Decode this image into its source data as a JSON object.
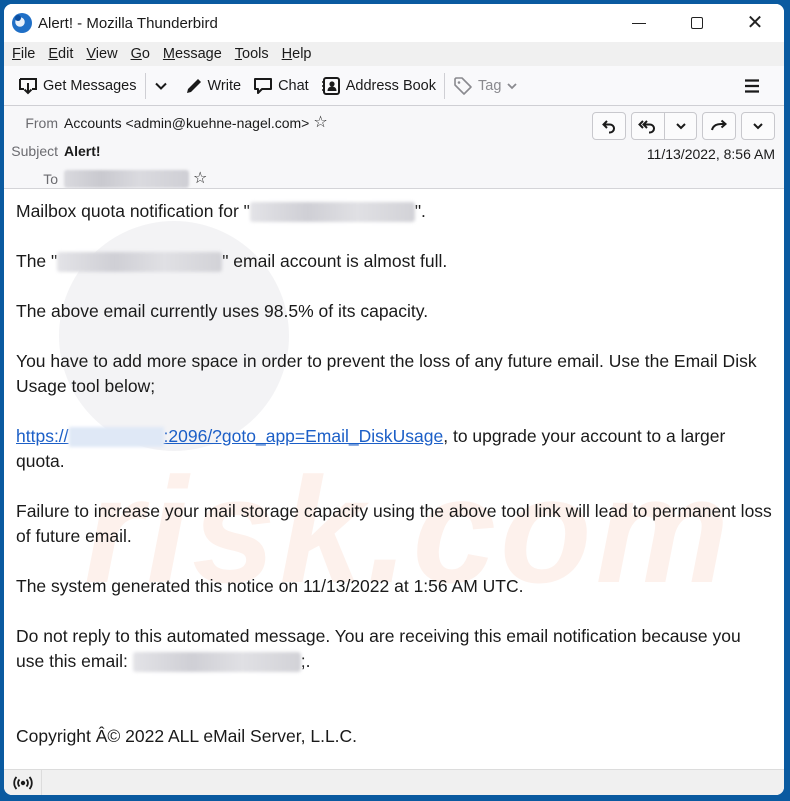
{
  "window": {
    "title": "Alert! - Mozilla Thunderbird",
    "controls": {
      "minimize": "minimize",
      "maximize": "maximize",
      "close": "close"
    }
  },
  "menu": {
    "items": [
      {
        "label": "File",
        "accel": "F",
        "rest": "ile"
      },
      {
        "label": "Edit",
        "accel": "E",
        "rest": "dit"
      },
      {
        "label": "View",
        "accel": "V",
        "rest": "iew"
      },
      {
        "label": "Go",
        "accel": "G",
        "rest": "o"
      },
      {
        "label": "Message",
        "accel": "M",
        "rest": "essage"
      },
      {
        "label": "Tools",
        "accel": "T",
        "rest": "ools"
      },
      {
        "label": "Help",
        "accel": "H",
        "rest": "elp"
      }
    ]
  },
  "toolbar": {
    "get_messages": "Get Messages",
    "write": "Write",
    "chat": "Chat",
    "address_book": "Address Book",
    "tag": "Tag"
  },
  "header": {
    "from_label": "From",
    "from_value": "Accounts <admin@kuehne-nagel.com>",
    "subject_label": "Subject",
    "subject_value": "Alert!",
    "to_label": "To",
    "to_value": "[redacted]",
    "date": "11/13/2022, 8:56 AM",
    "actions": [
      "reply",
      "reply-all",
      "reply-all-menu",
      "forward",
      "more-menu"
    ]
  },
  "message": {
    "p1_prefix": "Mailbox quota notification for \"",
    "p1_suffix": "\".",
    "p2_prefix": "The \"",
    "p2_suffix": "\" email account is almost full.",
    "p3": "The above email currently uses 98.5% of its capacity.",
    "p4": "You have to add more space in order to prevent the loss of any future email. Use the Email Disk Usage tool below;",
    "link_prefix": "https://",
    "link_suffix": ":2096/?goto_app=Email_DiskUsage",
    "p5_after_link": ", to upgrade your account to a larger quota.",
    "p6": "Failure to increase your mail storage capacity using the above tool link will lead to permanent loss of future email.",
    "p7": "The system generated this notice on 11/13/2022 at 1:56 AM UTC.",
    "p8_prefix": "Do not reply to this automated message. You are receiving this email notification because you use this email: ",
    "p8_suffix": ";.",
    "copyright": "Copyright Â© 2022 ALL eMail Server, L.L.C.",
    "redacted_placeholder": "[redacted]"
  },
  "watermark": {
    "text": "risk.com"
  },
  "statusbar": {
    "icon": "online-status-icon"
  }
}
